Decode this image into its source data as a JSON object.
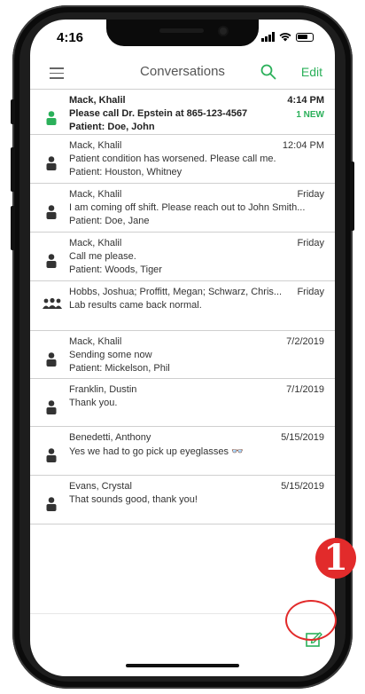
{
  "status_bar": {
    "time": "4:16"
  },
  "nav": {
    "title": "Conversations",
    "edit_label": "Edit"
  },
  "colors": {
    "accent": "#2bb05a",
    "annotation": "#e22b2b"
  },
  "conversations": [
    {
      "name": "Mack, Khalil",
      "time": "4:14 PM",
      "message": "Please call Dr. Epstein at 865-123-4567",
      "patient": "Patient: Doe, John",
      "badge": "1 NEW",
      "unread": true,
      "icon": "person-icon"
    },
    {
      "name": "Mack, Khalil",
      "time": "12:04 PM",
      "message": "Patient condition has worsened. Please call me.",
      "patient": "Patient: Houston, Whitney",
      "icon": "person-icon"
    },
    {
      "name": "Mack, Khalil",
      "time": "Friday",
      "message": "I am coming off shift. Please reach out to John Smith...",
      "patient": "Patient: Doe, Jane",
      "icon": "person-icon"
    },
    {
      "name": "Mack, Khalil",
      "time": "Friday",
      "message": "Call me please.",
      "patient": "Patient: Woods, Tiger",
      "icon": "person-icon"
    },
    {
      "name": "Hobbs, Joshua; Proffitt, Megan; Schwarz, Chris...",
      "time": "Friday",
      "message": "Lab results came back normal.",
      "patient": "",
      "icon": "group-icon"
    },
    {
      "name": "Mack, Khalil",
      "time": "7/2/2019",
      "message": "Sending some now",
      "patient": "Patient: Mickelson, Phil",
      "icon": "person-icon"
    },
    {
      "name": "Franklin, Dustin",
      "time": "7/1/2019",
      "message": "Thank you.",
      "patient": "",
      "icon": "person-icon"
    },
    {
      "name": "Benedetti, Anthony",
      "time": "5/15/2019",
      "message": "Yes we had to go pick up eyeglasses 👓",
      "patient": "",
      "icon": "person-icon"
    },
    {
      "name": "Evans, Crystal",
      "time": "5/15/2019",
      "message": "That sounds good, thank you!",
      "patient": "",
      "icon": "person-icon"
    }
  ],
  "annotation": {
    "number": "1"
  }
}
